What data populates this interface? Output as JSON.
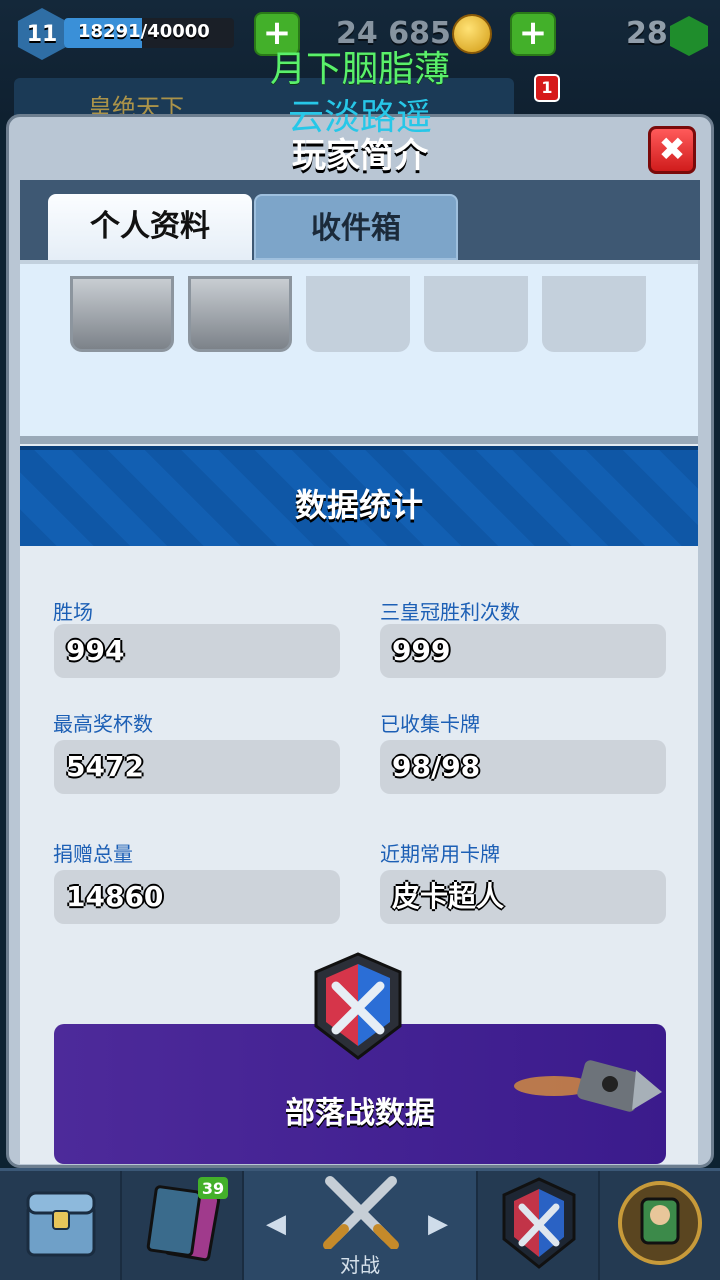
{
  "topbar": {
    "level": "11",
    "xp_text": "18291/40000",
    "xp_progress": 0.457,
    "gold": "24 685",
    "gems": "28",
    "clan_name": "皇绝天下",
    "notification_count": "1",
    "plus_icon": "plus-icon",
    "coin_icon": "gold-coin-icon",
    "gem_icon": "gem-icon"
  },
  "overlay": {
    "line1": "月下胭脂薄",
    "line2": "云淡路遥"
  },
  "panel": {
    "title": "玩家简介",
    "close_label": "✖",
    "tabs": [
      {
        "label": "个人资料",
        "active": true
      },
      {
        "label": "收件箱",
        "active": false
      }
    ]
  },
  "stats": {
    "header": "数据统计",
    "items": [
      {
        "label": "胜场",
        "value": "994"
      },
      {
        "label": "三皇冠胜利次数",
        "value": "999"
      },
      {
        "label": "最高奖杯数",
        "value": "5472"
      },
      {
        "label": "已收集卡牌",
        "value": "98/98"
      },
      {
        "label": "捐赠总量",
        "value": "14860"
      },
      {
        "label": "近期常用卡牌",
        "value": "皮卡超人"
      }
    ]
  },
  "clan_war": {
    "label": "部落战数据"
  },
  "bottom_nav": {
    "battle_label": "对战",
    "cards_badge": "39"
  },
  "colors": {
    "accent_blue": "#0f57a6",
    "label_blue": "#1c5fb5",
    "close_red": "#d01c1c",
    "war_purple": "#4d2a9a",
    "overlay_green": "#5af06b",
    "overlay_cyan": "#27c7e8"
  }
}
